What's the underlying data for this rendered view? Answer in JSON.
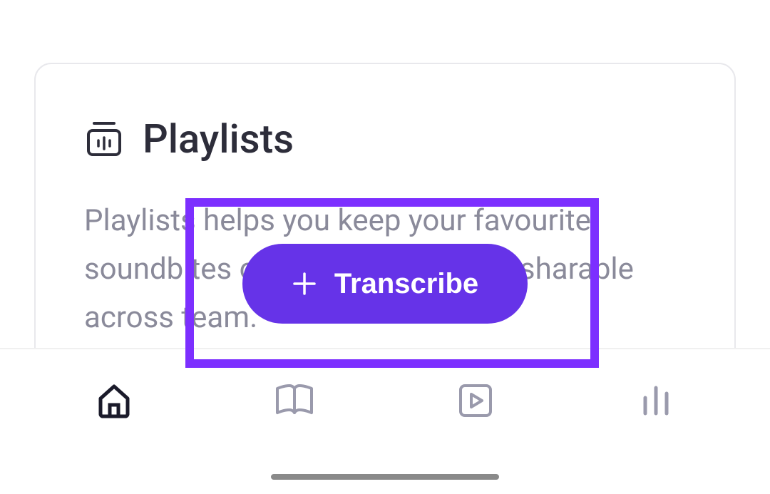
{
  "card": {
    "title": "Playlists",
    "description": "Playlists helps you keep your favourite soundbites organised and easily sharable across team."
  },
  "button": {
    "label": "Transcribe"
  },
  "colors": {
    "accent": "#6633e8",
    "highlight": "#7c2fff"
  }
}
